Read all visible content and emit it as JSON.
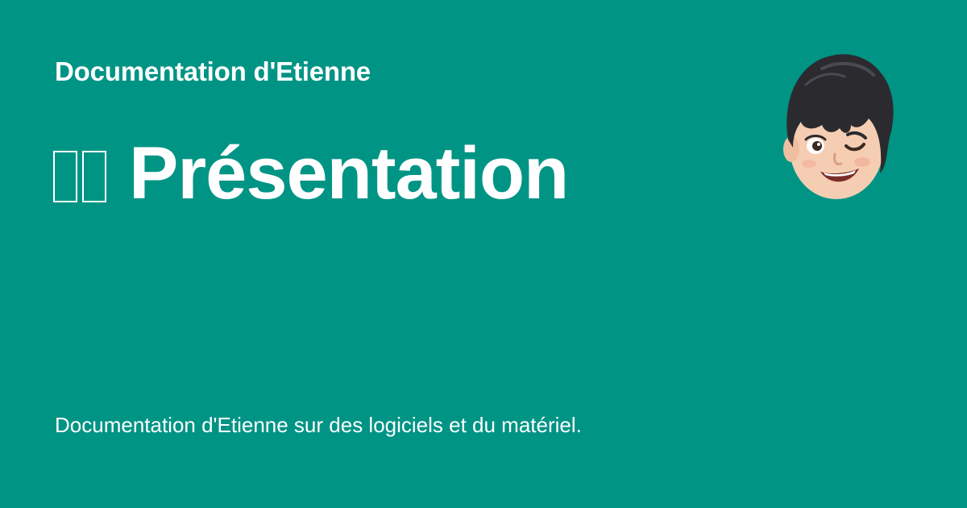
{
  "card": {
    "site_name": "Documentation d'Etienne",
    "title": "Présentation",
    "description": "Documentation d'Etienne sur des logiciels et du matériel."
  },
  "colors": {
    "background": "#009485",
    "text": "#ffffff"
  },
  "icons": {
    "title_prefix": "missing-glyph-icon",
    "avatar": "memoji-avatar-winking"
  }
}
